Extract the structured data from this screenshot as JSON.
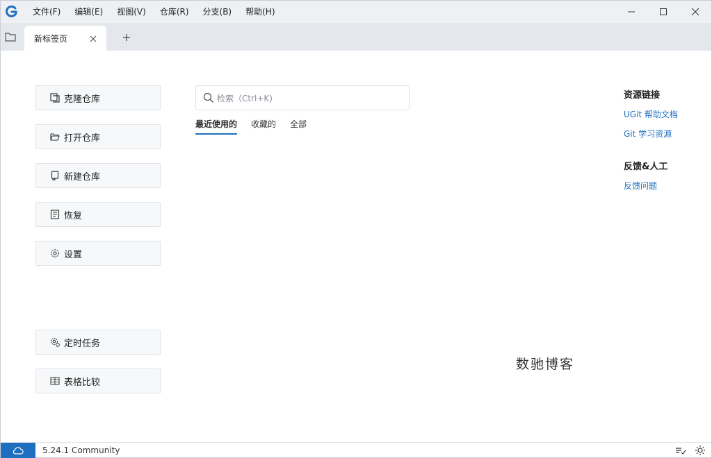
{
  "menu": [
    "文件(F)",
    "编辑(E)",
    "视图(V)",
    "仓库(R)",
    "分支(B)",
    "帮助(H)"
  ],
  "tab": {
    "label": "新标签页"
  },
  "actions": {
    "clone": "克隆仓库",
    "open": "打开仓库",
    "new": "新建仓库",
    "restore": "恢复",
    "settings": "设置",
    "scheduled": "定时任务",
    "compare": "表格比较"
  },
  "search": {
    "placeholder": "检索（Ctrl+K)",
    "value": ""
  },
  "repo_tabs": [
    "最近使用的",
    "收藏的",
    "全部"
  ],
  "resources": {
    "title": "资源链接",
    "links": [
      "UGit 帮助文档",
      "Git 学习资源"
    ],
    "feedback_title": "反馈&人工",
    "feedback_link": "反馈问题"
  },
  "watermark": "数驰博客",
  "status": {
    "version": "5.24.1 Community"
  },
  "colors": {
    "accent": "#1f6fbf",
    "titlebar": "#eef0f4",
    "tabbar": "#e4e7ec"
  },
  "icons": [
    "app-logo-icon",
    "folder-icon",
    "close-icon",
    "plus-icon",
    "search-icon",
    "cloud-icon",
    "gear-icon",
    "sun-icon"
  ]
}
